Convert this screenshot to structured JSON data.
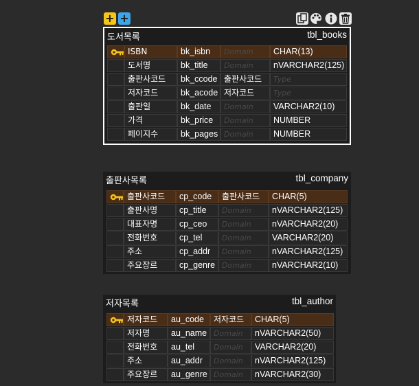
{
  "toolbar": {
    "add_table_label": "+",
    "add_field_label": "+",
    "icons": [
      "copy-icon",
      "palette-icon",
      "info-icon",
      "trash-icon"
    ]
  },
  "colors": {
    "background": "#2b2b2b",
    "table": "#1c1c1c",
    "cell": "#262626",
    "pk_row": "#4a2d17",
    "yellow": "#f5c518",
    "blue": "#3ea6e6"
  },
  "tables": [
    {
      "name": "도서목록",
      "physical": "tbl_books",
      "rows": [
        {
          "pk": true,
          "logical": "ISBN",
          "physical": "bk_isbn",
          "domain": "",
          "domain_ph": "Domain",
          "type": "CHAR(13)",
          "type_ph": ""
        },
        {
          "pk": false,
          "logical": "도서명",
          "physical": "bk_title",
          "domain": "",
          "domain_ph": "Domain",
          "type": "nVARCHAR2(125)",
          "type_ph": ""
        },
        {
          "pk": false,
          "logical": "출판사코드",
          "physical": "bk_ccode",
          "domain": "출판사코드",
          "domain_ph": "",
          "type": "",
          "type_ph": "Type"
        },
        {
          "pk": false,
          "logical": "저자코드",
          "physical": "bk_acode",
          "domain": "저자코드",
          "domain_ph": "",
          "type": "",
          "type_ph": "Type"
        },
        {
          "pk": false,
          "logical": "출판일",
          "physical": "bk_date",
          "domain": "",
          "domain_ph": "Domain",
          "type": "VARCHAR2(10)",
          "type_ph": ""
        },
        {
          "pk": false,
          "logical": "가격",
          "physical": "bk_price",
          "domain": "",
          "domain_ph": "Domain",
          "type": "NUMBER",
          "type_ph": ""
        },
        {
          "pk": false,
          "logical": "페이지수",
          "physical": "bk_pages",
          "domain": "",
          "domain_ph": "Domain",
          "type": "NUMBER",
          "type_ph": ""
        }
      ]
    },
    {
      "name": "출판사목록",
      "physical": "tbl_company",
      "rows": [
        {
          "pk": true,
          "logical": "출판사코드",
          "physical": "cp_code",
          "domain": "출판사코드",
          "domain_ph": "",
          "type": "CHAR(5)",
          "type_ph": ""
        },
        {
          "pk": false,
          "logical": "출판사명",
          "physical": "cp_title",
          "domain": "",
          "domain_ph": "Domain",
          "type": "nVARCHAR2(125)",
          "type_ph": ""
        },
        {
          "pk": false,
          "logical": "대표자명",
          "physical": "cp_ceo",
          "domain": "",
          "domain_ph": "Domain",
          "type": "nVARCHAR2(20)",
          "type_ph": ""
        },
        {
          "pk": false,
          "logical": "전화번호",
          "physical": "cp_tel",
          "domain": "",
          "domain_ph": "Domain",
          "type": "VARCHAR2(20)",
          "type_ph": ""
        },
        {
          "pk": false,
          "logical": "주소",
          "physical": "cp_addr",
          "domain": "",
          "domain_ph": "Domain",
          "type": "nVARCHAR2(125)",
          "type_ph": ""
        },
        {
          "pk": false,
          "logical": "주요장르",
          "physical": "cp_genre",
          "domain": "",
          "domain_ph": "Domain",
          "type": "nVARCHAR2(10)",
          "type_ph": ""
        }
      ]
    },
    {
      "name": "저자목록",
      "physical": "tbl_author",
      "rows": [
        {
          "pk": true,
          "logical": "저자코드",
          "physical": "au_code",
          "domain": "저자코드",
          "domain_ph": "",
          "type": "CHAR(5)",
          "type_ph": ""
        },
        {
          "pk": false,
          "logical": "저자명",
          "physical": "au_name",
          "domain": "",
          "domain_ph": "Domain",
          "type": "nVARCHAR2(50)",
          "type_ph": ""
        },
        {
          "pk": false,
          "logical": "전화번호",
          "physical": "au_tel",
          "domain": "",
          "domain_ph": "Domain",
          "type": "VARCHAR2(20)",
          "type_ph": ""
        },
        {
          "pk": false,
          "logical": "주소",
          "physical": "au_addr",
          "domain": "",
          "domain_ph": "Domain",
          "type": "nVARCHAR2(125)",
          "type_ph": ""
        },
        {
          "pk": false,
          "logical": "주요장르",
          "physical": "au_genre",
          "domain": "",
          "domain_ph": "Domain",
          "type": "nVARCHAR2(30)",
          "type_ph": ""
        }
      ]
    }
  ]
}
